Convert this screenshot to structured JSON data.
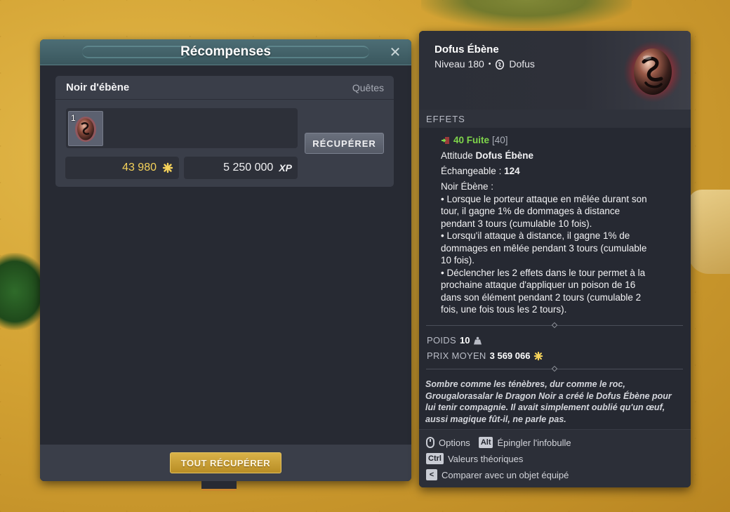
{
  "rewards_window": {
    "title": "Récompenses",
    "close_glyph": "✕",
    "card": {
      "title": "Noir d'ébène",
      "source": "Quêtes",
      "item_quantity": "1",
      "item_icon": "dofus-ebene-egg",
      "collect_label": "RÉCUPÉRER",
      "kamas": "43 980",
      "xp": "5 250 000",
      "xp_tag": "XP"
    },
    "collect_all_label": "TOUT RÉCUPÉRER"
  },
  "tooltip": {
    "name": "Dofus Ébène",
    "level": "Niveau 180",
    "bullet": "•",
    "type": "Dofus",
    "section_effects": "EFFETS",
    "effects": {
      "flee_value": "40 Fuite",
      "flee_base": "[40]",
      "attitude_prefix": "Attitude",
      "attitude_name": "Dofus Ébène",
      "exchangeable_prefix": "Échangeable :",
      "exchangeable_value": "124",
      "set_name": "Noir Ébène :",
      "description_lines": [
        "• Lorsque le porteur attaque en mêlée durant son",
        "tour, il gagne 1% de dommages à distance",
        "pendant 3 tours (cumulable 10 fois).",
        "• Lorsqu'il attaque à distance, il gagne 1% de",
        "dommages en mêlée pendant 3 tours (cumulable",
        "10 fois).",
        "• Déclencher les 2 effets dans le tour permet à la",
        "prochaine attaque d'appliquer un poison de 16",
        "dans son élément pendant 2 tours (cumulable 2",
        "fois, une fois tous les 2 tours)."
      ]
    },
    "weight_label": "POIDS",
    "weight_value": "10",
    "avg_price_label": "PRIX MOYEN",
    "avg_price_value": "3 569 066",
    "lore_lines": [
      "Sombre comme les ténèbres, dur comme le roc,",
      "Grougalorasalar le Dragon Noir a créé le Dofus Ébène pour",
      "lui tenir compagnie. Il avait simplement oublié qu'un œuf,",
      "aussi magique fût-il, ne parle pas."
    ],
    "hints": {
      "options_label": "Options",
      "alt_key": "Alt",
      "pin_label": "Épingler l'infobulle",
      "ctrl_key": "Ctrl",
      "theoretical_label": "Valeurs théoriques",
      "compare_key": "<",
      "compare_label": "Comparer avec un objet équipé"
    }
  },
  "colors": {
    "kamas": "#f5d25a",
    "green_stat": "#7fd64b",
    "gold_button": "#d9b248",
    "header_teal": "#4d6e75"
  }
}
